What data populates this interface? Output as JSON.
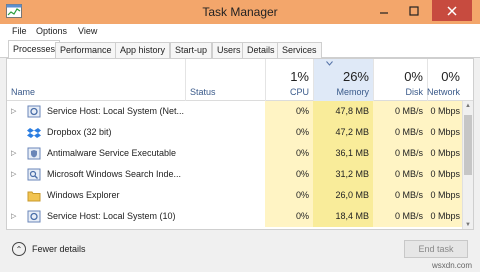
{
  "window": {
    "title": "Task Manager"
  },
  "menu": [
    "File",
    "Options",
    "View"
  ],
  "tabs": [
    "Processes",
    "Performance",
    "App history",
    "Start-up",
    "Users",
    "Details",
    "Services"
  ],
  "columns": {
    "name": "Name",
    "status": "Status",
    "cpu": {
      "pct": "1%",
      "label": "CPU"
    },
    "memory": {
      "pct": "26%",
      "label": "Memory"
    },
    "disk": {
      "pct": "0%",
      "label": "Disk"
    },
    "network": {
      "pct": "0%",
      "label": "Network"
    }
  },
  "processes": [
    {
      "name": "Service Host: Local System (Net...",
      "cpu": "0%",
      "memory": "47,8 MB",
      "disk": "0 MB/s",
      "network": "0 Mbps",
      "expandable": true,
      "icon": "gear-icon"
    },
    {
      "name": "Dropbox (32 bit)",
      "cpu": "0%",
      "memory": "47,2 MB",
      "disk": "0 MB/s",
      "network": "0 Mbps",
      "expandable": false,
      "icon": "dropbox-icon"
    },
    {
      "name": "Antimalware Service Executable",
      "cpu": "0%",
      "memory": "36,1 MB",
      "disk": "0 MB/s",
      "network": "0 Mbps",
      "expandable": true,
      "icon": "shield-icon"
    },
    {
      "name": "Microsoft Windows Search Inde...",
      "cpu": "0%",
      "memory": "31,2 MB",
      "disk": "0 MB/s",
      "network": "0 Mbps",
      "expandable": true,
      "icon": "search-icon"
    },
    {
      "name": "Windows Explorer",
      "cpu": "0%",
      "memory": "26,0 MB",
      "disk": "0 MB/s",
      "network": "0 Mbps",
      "expandable": false,
      "icon": "folder-icon"
    },
    {
      "name": "Service Host: Local System (10)",
      "cpu": "0%",
      "memory": "18,4 MB",
      "disk": "0 MB/s",
      "network": "0 Mbps",
      "expandable": true,
      "icon": "gear-icon"
    }
  ],
  "footer": {
    "fewer": "Fewer details",
    "end_task": "End task"
  },
  "watermark": "wsxdn.com"
}
